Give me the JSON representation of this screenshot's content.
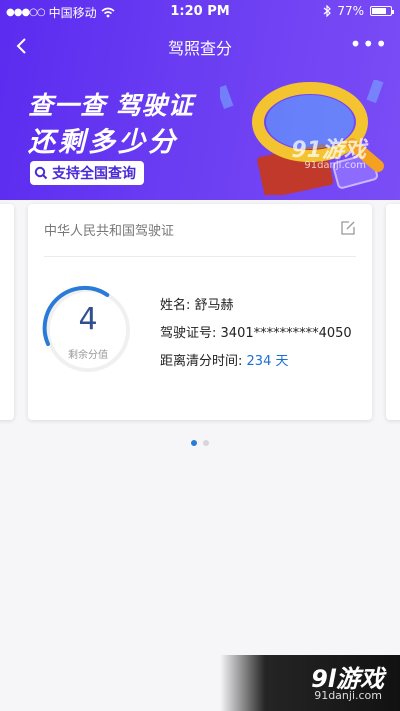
{
  "status": {
    "carrier": "中国移动",
    "time": "1:20 PM",
    "battery": "77%",
    "battery_level": 0.77
  },
  "nav": {
    "title": "驾照查分",
    "back_icon": "chevron-left-icon",
    "more_icon": "more-icon"
  },
  "banner": {
    "line1": "查一查 驾驶证",
    "line2": "还剩多少分",
    "button_label": "支持全国查询",
    "watermark": "91游戏",
    "watermark_url": "91danji.com"
  },
  "card": {
    "header": "中华人民共和国驾驶证",
    "remaining_points": "4",
    "remaining_label": "剩余分值",
    "points_fraction": 0.33,
    "name_label": "姓名:",
    "name_value": "舒马赫",
    "license_label": "驾驶证号:",
    "license_value": "3401**********4050",
    "clear_label": "距离清分时间:",
    "clear_value": "234 天"
  },
  "pager": {
    "total": 2,
    "active": 0
  },
  "footer_watermark": {
    "big": "9l游戏",
    "small": "91danji.com"
  }
}
